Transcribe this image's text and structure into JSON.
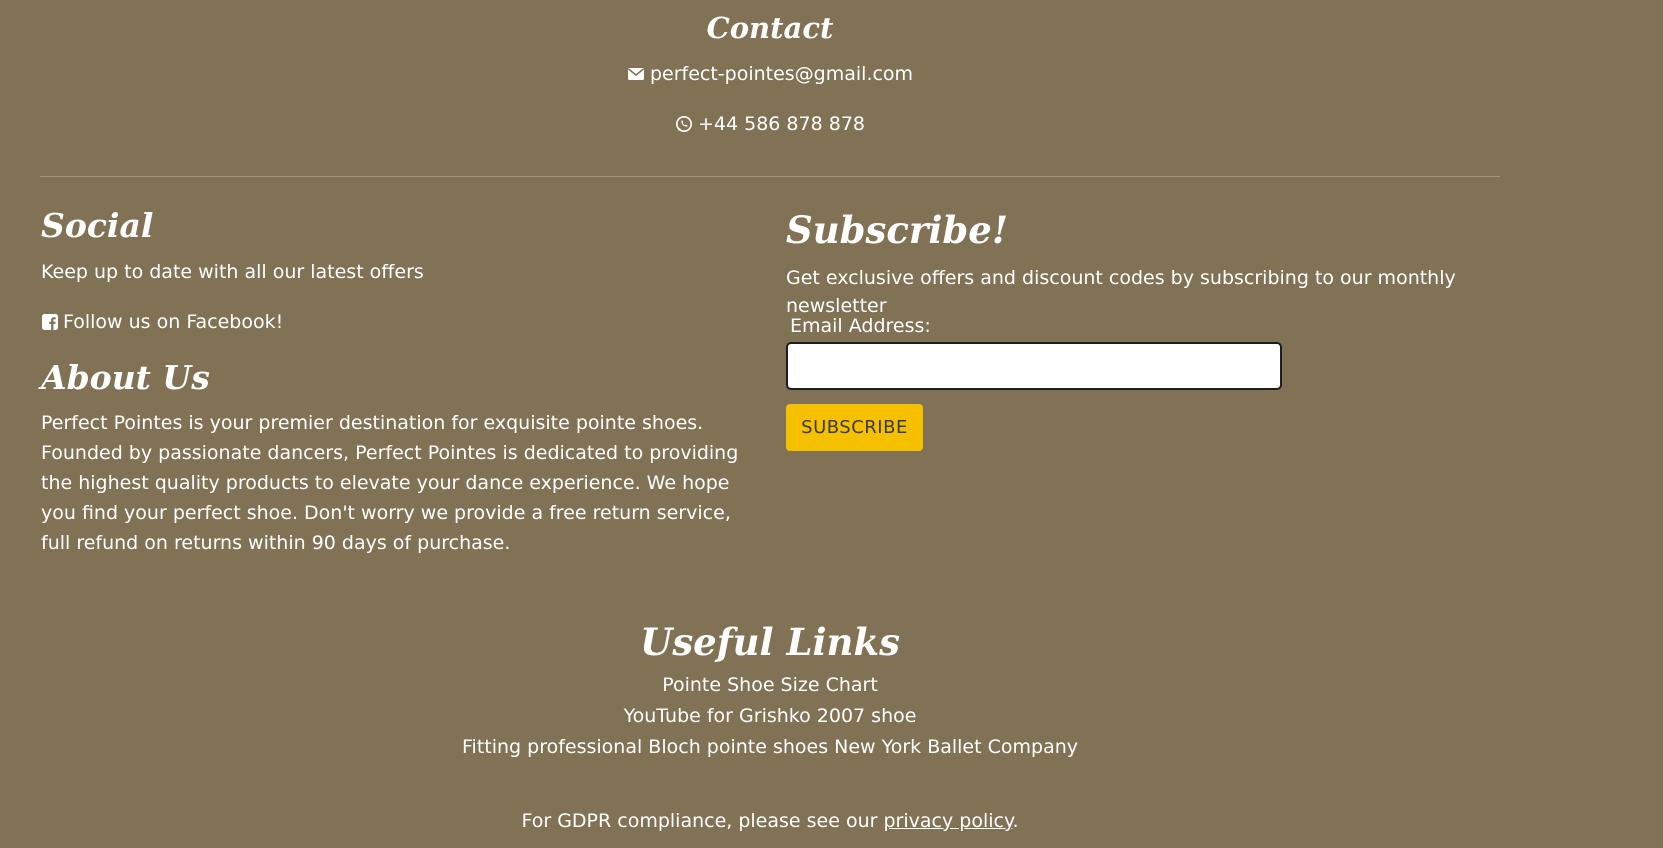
{
  "contact": {
    "heading": "Contact",
    "email": "perfect-pointes@gmail.com",
    "email_icon": "envelope-icon",
    "phone": "+44 586 878 878",
    "phone_icon": "whatsapp-icon"
  },
  "social": {
    "heading": "Social",
    "text": "Keep up to date with all our latest offers",
    "facebook_icon": "facebook-square-icon",
    "facebook_link": "Follow us on Facebook!"
  },
  "about": {
    "heading": "About Us",
    "text": "Perfect Pointes is your premier destination for exquisite pointe shoes. Founded by passionate dancers, Perfect Pointes is dedicated to providing the highest quality products to elevate your dance experience. We hope you find your perfect shoe. Don't worry we provide a free return service, full refund on returns within 90 days of purchase."
  },
  "subscribe": {
    "heading": "Subscribe!",
    "text": "Get exclusive offers and discount codes by subscribing to our monthly newsletter",
    "email_label": "Email Address:",
    "email_value": "",
    "button_label": "SUBSCRIBE"
  },
  "links": {
    "heading": "Useful Links",
    "items": [
      "Pointe Shoe Size Chart",
      "YouTube for Grishko 2007 shoe",
      "Fitting professional Bloch pointe shoes New York Ballet Company"
    ]
  },
  "gdpr": {
    "prefix": "For GDPR compliance, please see our ",
    "link": "privacy policy",
    "suffix": "."
  },
  "colors": {
    "background": "#827255",
    "text": "#ffffff",
    "button": "#f5c000",
    "divider": "#a59476"
  }
}
